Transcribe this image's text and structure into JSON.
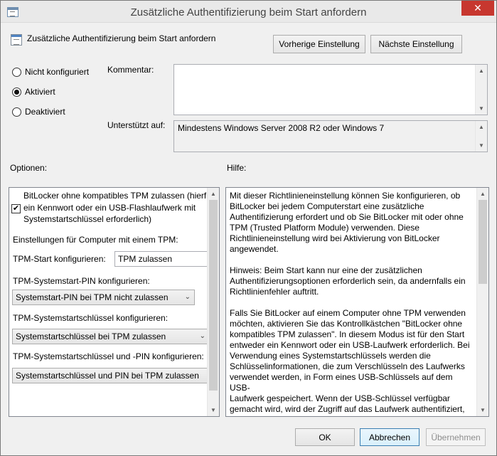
{
  "window": {
    "title": "Zusätzliche Authentifizierung beim Start anfordern",
    "close_glyph": "✕"
  },
  "header": {
    "setting_name": "Zusätzliche Authentifizierung beim Start anfordern",
    "prev_button": "Vorherige Einstellung",
    "next_button": "Nächste Einstellung"
  },
  "state": {
    "options": [
      {
        "label": "Nicht konfiguriert",
        "checked": false
      },
      {
        "label": "Aktiviert",
        "checked": true
      },
      {
        "label": "Deaktiviert",
        "checked": false
      }
    ]
  },
  "comment": {
    "label": "Kommentar:",
    "value": ""
  },
  "supported": {
    "label": "Unterstützt auf:",
    "value": "Mindestens Windows Server 2008 R2 oder Windows 7"
  },
  "section_labels": {
    "options": "Optionen:",
    "help": "Hilfe:"
  },
  "options_panel": {
    "checkbox_line1": "BitLocker ohne kompatibles TPM zulassen (hierfü",
    "checkbox_line2": "ein Kennwort oder ein USB-Flashlaufwerk mit",
    "checkbox_line3": "Systemstartschlüssel erforderlich)",
    "checkbox_checked": true,
    "tpm_settings_heading": "Einstellungen für Computer mit einem TPM:",
    "tpm_start_label": "TPM-Start konfigurieren:",
    "tpm_start_value": "TPM zulassen",
    "tpm_pin_label": "TPM-Systemstart-PIN konfigurieren:",
    "tpm_pin_value": "Systemstart-PIN bei TPM nicht zulassen",
    "tpm_key_label": "TPM-Systemstartschlüssel konfigurieren:",
    "tpm_key_value": "Systemstartschlüssel bei TPM zulassen",
    "tpm_key_pin_label": "TPM-Systemstartschlüssel und -PIN konfigurieren:",
    "tpm_key_pin_value": "Systemstartschlüssel und PIN bei TPM zulassen"
  },
  "help_panel": {
    "text": "Mit dieser Richtlinieneinstellung können Sie konfigurieren, ob\nBitLocker bei jedem Computerstart eine zusätzliche\nAuthentifizierung erfordert und ob Sie BitLocker mit oder ohne\nTPM (Trusted Platform Module) verwenden. Diese\nRichtlinieneinstellung wird bei Aktivierung von BitLocker\nangewendet.\n\nHinweis: Beim Start kann nur eine der zusätzlichen\nAuthentifizierungsoptionen erforderlich sein, da andernfalls ein\nRichtlinienfehler auftritt.\n\nFalls Sie BitLocker auf einem Computer ohne TPM verwenden\nmöchten, aktivieren Sie das Kontrollkästchen \"BitLocker ohne\nkompatibles TPM zulassen\". In diesem Modus ist für den Start\nentweder ein Kennwort oder ein USB-Laufwerk erforderlich. Bei\nVerwendung eines Systemstartschlüssels werden die\nSchlüsselinformationen, die zum Verschlüsseln des Laufwerks\nverwendet werden, in Form eines USB-Schlüssels auf dem USB-\nLaufwerk gespeichert. Wenn der USB-Schlüssel verfügbar\ngemacht wird, wird der Zugriff auf das Laufwerk authentifiziert,\nund es kann auf das Laufwerk zugegriffen werden. Wenn der"
  },
  "footer": {
    "ok": "OK",
    "cancel": "Abbrechen",
    "apply": "Übernehmen"
  },
  "icons": {
    "chevron_down": "▼",
    "chevron_up": "▲",
    "chevron_select": "⌄"
  }
}
